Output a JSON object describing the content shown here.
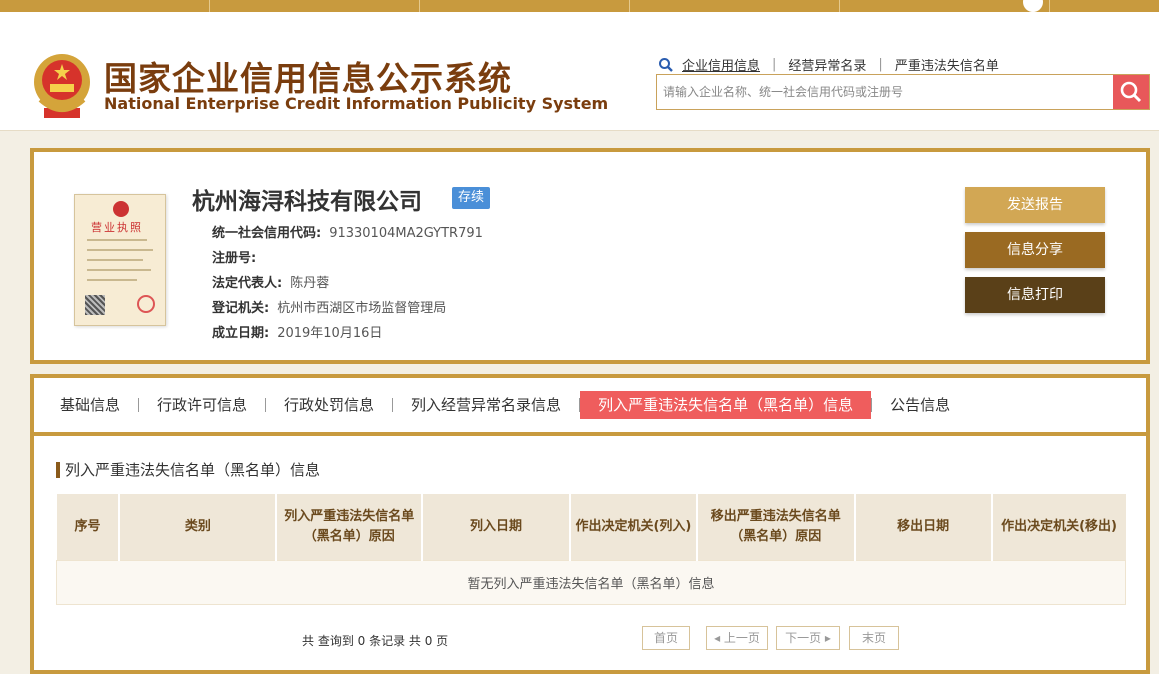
{
  "site": {
    "title_cn": "国家企业信用信息公示系统",
    "title_en": "National Enterprise Credit Information Publicity System"
  },
  "search": {
    "links": [
      "企业信用信息",
      "经营异常名录",
      "严重违法失信名单"
    ],
    "placeholder": "请输入企业名称、统一社会信用代码或注册号"
  },
  "company": {
    "name": "杭州海浔科技有限公司",
    "status": "存续",
    "license_title": "营业执照",
    "fields": [
      {
        "label": "统一社会信用代码:",
        "value": "91330104MA2GYTR791"
      },
      {
        "label": "注册号:",
        "value": ""
      },
      {
        "label": "法定代表人:",
        "value": "陈丹蓉"
      },
      {
        "label": "登记机关:",
        "value": "杭州市西湖区市场监督管理局"
      },
      {
        "label": "成立日期:",
        "value": "2019年10月16日"
      }
    ]
  },
  "actions": {
    "send_report": "发送报告",
    "share": "信息分享",
    "print": "信息打印"
  },
  "tabs": [
    {
      "label": "基础信息",
      "active": false
    },
    {
      "label": "行政许可信息",
      "active": false
    },
    {
      "label": "行政处罚信息",
      "active": false
    },
    {
      "label": "列入经营异常名录信息",
      "active": false
    },
    {
      "label": "列入严重违法失信名单（黑名单）信息",
      "active": true
    },
    {
      "label": "公告信息",
      "active": false
    }
  ],
  "section": {
    "title": "列入严重违法失信名单（黑名单）信息",
    "columns": [
      "序号",
      "类别",
      "列入严重违法失信名单（黑名单）原因",
      "列入日期",
      "作出决定机关(列入)",
      "移出严重违法失信名单（黑名单）原因",
      "移出日期",
      "作出决定机关(移出)"
    ],
    "empty_text": "暂无列入严重违法失信名单（黑名单）信息"
  },
  "pager": {
    "summary": "共 查询到 0 条记录 共 0 页",
    "first": "首页",
    "prev": "◂ 上一页",
    "next": "下一页 ▸",
    "last": "末页"
  },
  "colors": {
    "gold": "#c89a3e",
    "active_tab": "#ef5d5d",
    "status_badge": "#4a8fd8",
    "brand_text": "#7a3d0e"
  }
}
